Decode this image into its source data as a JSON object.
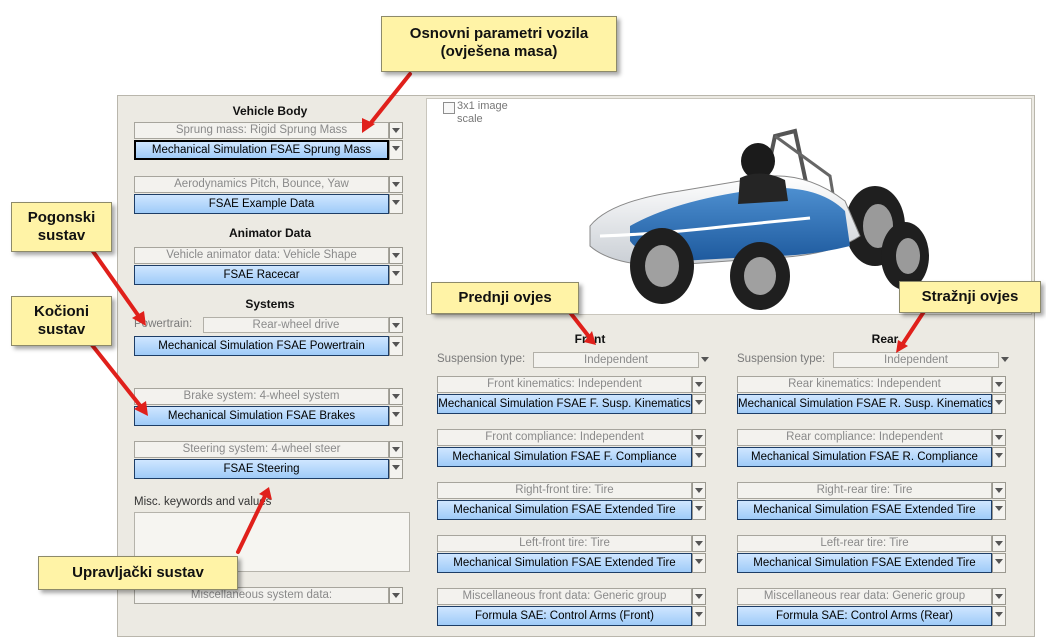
{
  "callouts": {
    "osnovni": "Osnovni parametri vozila (ovješena masa)",
    "pogonski": "Pogonski sustav",
    "kocioni": "Kočioni sustav",
    "upravljacki": "Upravljački sustav",
    "prednji": "Prednji ovjes",
    "straznji": "Stražnji ovjes"
  },
  "image_panel": {
    "checkbox_label": "3x1 image scale"
  },
  "vehicle_body": {
    "heading": "Vehicle Body",
    "sprung_label": "Sprung mass: Rigid Sprung Mass",
    "sprung_value": "Mechanical Simulation FSAE Sprung Mass",
    "aero_label": "Aerodynamics Pitch, Bounce, Yaw",
    "aero_value": "FSAE Example Data"
  },
  "animator": {
    "heading": "Animator Data",
    "shape_label": "Vehicle animator data: Vehicle Shape",
    "shape_value": "FSAE Racecar"
  },
  "systems": {
    "heading": "Systems",
    "powertrain_label": "Powertrain:",
    "powertrain_drive": "Rear-wheel drive",
    "powertrain_value": "Mechanical Simulation FSAE Powertrain",
    "brake_label": "Brake system: 4-wheel system",
    "brake_value": "Mechanical Simulation FSAE Brakes",
    "steering_label": "Steering system: 4-wheel steer",
    "steering_value": "FSAE Steering",
    "misc_label": "Misc. keywords and values",
    "misc_system_label": "Miscellaneous system data:"
  },
  "front": {
    "heading": "Front",
    "susp_type_label": "Suspension type:",
    "susp_type_value": "Independent",
    "kin_label": "Front kinematics: Independent",
    "kin_value": "Mechanical Simulation FSAE F. Susp. Kinematics",
    "comp_label": "Front compliance: Independent",
    "comp_value": "Mechanical Simulation FSAE F. Compliance",
    "rtire_label": "Right-front tire: Tire",
    "rtire_value": "Mechanical Simulation FSAE Extended Tire",
    "ltire_label": "Left-front tire: Tire",
    "ltire_value": "Mechanical Simulation FSAE Extended Tire",
    "misc_label": "Miscellaneous front data: Generic group",
    "misc_value": "Formula SAE: Control Arms (Front)"
  },
  "rear": {
    "heading": "Rear",
    "susp_type_label": "Suspension type:",
    "susp_type_value": "Independent",
    "kin_label": "Rear kinematics: Independent",
    "kin_value": "Mechanical Simulation FSAE R. Susp. Kinematics",
    "comp_label": "Rear compliance: Independent",
    "comp_value": "Mechanical Simulation FSAE R. Compliance",
    "rtire_label": "Right-rear tire: Tire",
    "rtire_value": "Mechanical Simulation FSAE Extended Tire",
    "ltire_label": "Left-rear tire: Tire",
    "ltire_value": "Mechanical Simulation FSAE Extended Tire",
    "misc_label": "Miscellaneous rear data: Generic group",
    "misc_value": "Formula SAE: Control Arms (Rear)"
  },
  "colors": {
    "link_blue": "#9fcbf8",
    "callout_yellow": "#fff3a6",
    "arrow_red": "#e0201b"
  }
}
